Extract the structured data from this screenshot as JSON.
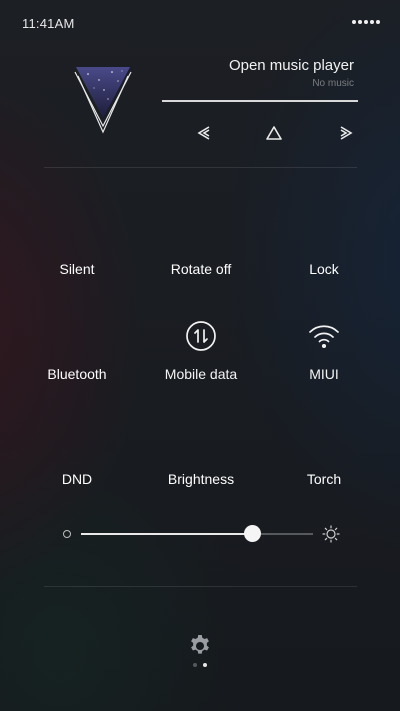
{
  "status": {
    "time": "11:41AM"
  },
  "player": {
    "title": "Open music player",
    "subtitle": "No music",
    "progress": 1.0,
    "controls": [
      "prev-icon",
      "play-icon",
      "next-icon"
    ]
  },
  "toggles": [
    {
      "label": "Silent",
      "icon": "bell-off-icon",
      "active": false
    },
    {
      "label": "Rotate off",
      "icon": "rotate-lock-icon",
      "active": false
    },
    {
      "label": "Lock",
      "icon": "lock-icon",
      "active": false
    },
    {
      "label": "Bluetooth",
      "icon": "bluetooth-icon",
      "active": false
    },
    {
      "label": "Mobile data",
      "icon": "mobile-data-icon",
      "active": true
    },
    {
      "label": "MIUI",
      "icon": "wifi-icon",
      "active": true
    },
    {
      "label": "DND",
      "icon": "moon-icon",
      "active": false
    },
    {
      "label": "Brightness",
      "icon": "auto-brightness-icon",
      "active": false
    },
    {
      "label": "Torch",
      "icon": "flashlight-icon",
      "active": false
    }
  ],
  "brightness": {
    "level": 0.74
  },
  "pager": {
    "pages": 2,
    "current": 1
  },
  "colors": {
    "active": "#f2f2f2",
    "inactive": "#6a6d72",
    "background": "#1a1d22"
  }
}
